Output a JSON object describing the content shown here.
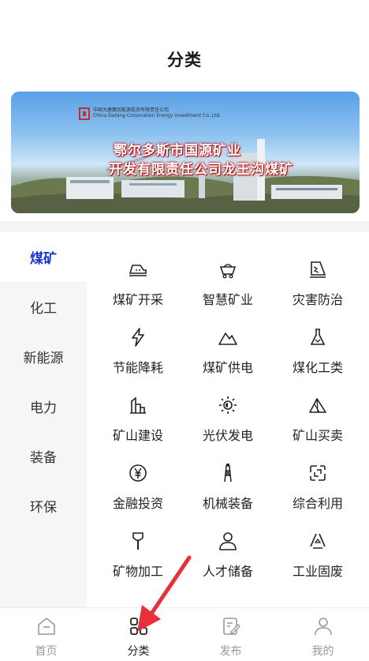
{
  "header": {
    "title": "分类"
  },
  "banner": {
    "company_line1": "中国大唐集团能源投资有限责任公司",
    "company_line2": "China Datang Corporation Energy Investment Co.,Ltd.",
    "headline_line1": "鄂尔多斯市国源矿业",
    "headline_line2": "开发有限责任公司龙王沟煤矿"
  },
  "sidebar": {
    "items": [
      {
        "label": "煤矿",
        "active": true
      },
      {
        "label": "化工"
      },
      {
        "label": "新能源"
      },
      {
        "label": "电力"
      },
      {
        "label": "装备"
      },
      {
        "label": "环保"
      }
    ]
  },
  "grid": {
    "items": [
      {
        "label": "煤矿开采",
        "icon": "mining-cart-icon"
      },
      {
        "label": "智慧矿业",
        "icon": "minecart-icon"
      },
      {
        "label": "灾害防治",
        "icon": "hazard-icon"
      },
      {
        "label": "节能降耗",
        "icon": "lightning-icon"
      },
      {
        "label": "煤矿供电",
        "icon": "mountain-icon"
      },
      {
        "label": "煤化工类",
        "icon": "flask-icon"
      },
      {
        "label": "矿山建设",
        "icon": "building-icon"
      },
      {
        "label": "光伏发电",
        "icon": "sun-icon"
      },
      {
        "label": "矿山买卖",
        "icon": "mountain-peak-icon"
      },
      {
        "label": "金融投资",
        "icon": "yen-coin-icon"
      },
      {
        "label": "机械装备",
        "icon": "oil-tower-icon"
      },
      {
        "label": "综合利用",
        "icon": "recycle-icon"
      },
      {
        "label": "矿物加工",
        "icon": "hammer-icon"
      },
      {
        "label": "人才储备",
        "icon": "person-icon"
      },
      {
        "label": "工业固废",
        "icon": "triangle-recycle-icon"
      }
    ]
  },
  "tabbar": {
    "items": [
      {
        "label": "首页",
        "icon": "home-icon"
      },
      {
        "label": "分类",
        "icon": "category-grid-icon",
        "active": true
      },
      {
        "label": "发布",
        "icon": "edit-icon"
      },
      {
        "label": "我的",
        "icon": "user-icon"
      }
    ]
  },
  "colors": {
    "accent": "#1a35d6",
    "sidebar_bg": "#f6f6f6",
    "arrow": "#e8303a"
  }
}
